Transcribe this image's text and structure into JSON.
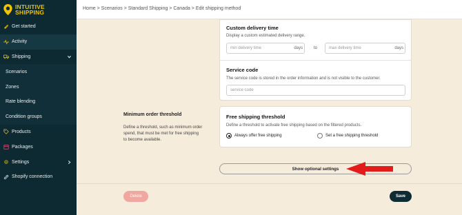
{
  "app": {
    "logo_line1": "INTUITIVE",
    "logo_line2": "SHIPPING"
  },
  "breadcrumb": "Home > Scenarios > Standard Shipping > Canada > Edit shipping method",
  "sidebar": {
    "items": [
      {
        "label": "Get started",
        "icon": "rocket-icon"
      },
      {
        "label": "Activity",
        "icon": "activity-icon"
      },
      {
        "label": "Shipping",
        "icon": "truck-icon"
      },
      {
        "label": "Scenarios"
      },
      {
        "label": "Zones"
      },
      {
        "label": "Rate blending"
      },
      {
        "label": "Condition groups"
      },
      {
        "label": "Products",
        "icon": "tag-icon"
      },
      {
        "label": "Packages",
        "icon": "package-icon"
      },
      {
        "label": "Settings",
        "icon": "gear-icon"
      },
      {
        "label": "Shopify connection",
        "icon": "link-icon"
      }
    ]
  },
  "delivery": {
    "title": "Custom delivery time",
    "desc": "Display a custom estimated delivery range.",
    "min_placeholder": "min delivery time",
    "max_placeholder": "max delivery time",
    "unit": "days",
    "to": "to"
  },
  "service": {
    "title": "Service code",
    "desc": "The service code is stored in the order information and is not visible to the customer.",
    "placeholder": "service code"
  },
  "threshold_side": {
    "heading": "Minimum order threshold",
    "desc": "Define a threshold, such as minimum order spend, that must be met for free shipping to become available."
  },
  "free_shipping": {
    "title": "Free shipping threshold",
    "desc": "Define a threshold to activate free shipping based on the filtered products.",
    "option_always": "Always offer free shipping",
    "option_set": "Set a free shipping threshold"
  },
  "optional_settings_label": "Show optional settings",
  "footer": {
    "delete_label": "Delete",
    "save_label": "Save"
  },
  "colors": {
    "sidebar_bg": "#0d2a33",
    "logo_yellow": "#f2c400",
    "page_bg": "#f6ecdc",
    "save_bg": "#0f2b33",
    "delete_bg": "#f0a7a0",
    "arrow_red": "#e21b1b"
  }
}
